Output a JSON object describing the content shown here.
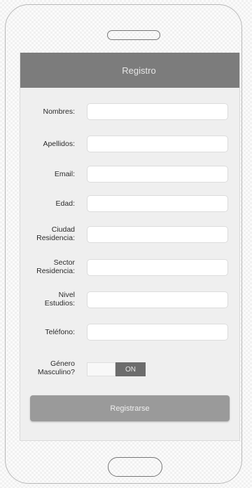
{
  "app_bar": {
    "title": "Registro"
  },
  "form": {
    "fields": [
      {
        "label": "Nombres:",
        "value": "",
        "placeholder": ""
      },
      {
        "label": "Apellidos:",
        "value": "",
        "placeholder": ""
      },
      {
        "label": "Email:",
        "value": "",
        "placeholder": ""
      },
      {
        "label": "Edad:",
        "value": "",
        "placeholder": ""
      },
      {
        "label": "Ciudad\nResidencia:",
        "value": "",
        "placeholder": ""
      },
      {
        "label": "Sector\nResidencia:",
        "value": "",
        "placeholder": ""
      },
      {
        "label": "Nivel\nEstudios:",
        "value": "",
        "placeholder": ""
      },
      {
        "label": "Teléfono:",
        "value": "",
        "placeholder": ""
      }
    ],
    "gender_toggle": {
      "label": "Género\nMasculino?",
      "state": "ON",
      "on": true
    },
    "submit_label": "Registrarse"
  },
  "colors": {
    "app_bar": "#7c7c7c",
    "screen_background": "#efefef",
    "toggle_on": "#6c6c6c",
    "button": "#9a9a9a"
  }
}
